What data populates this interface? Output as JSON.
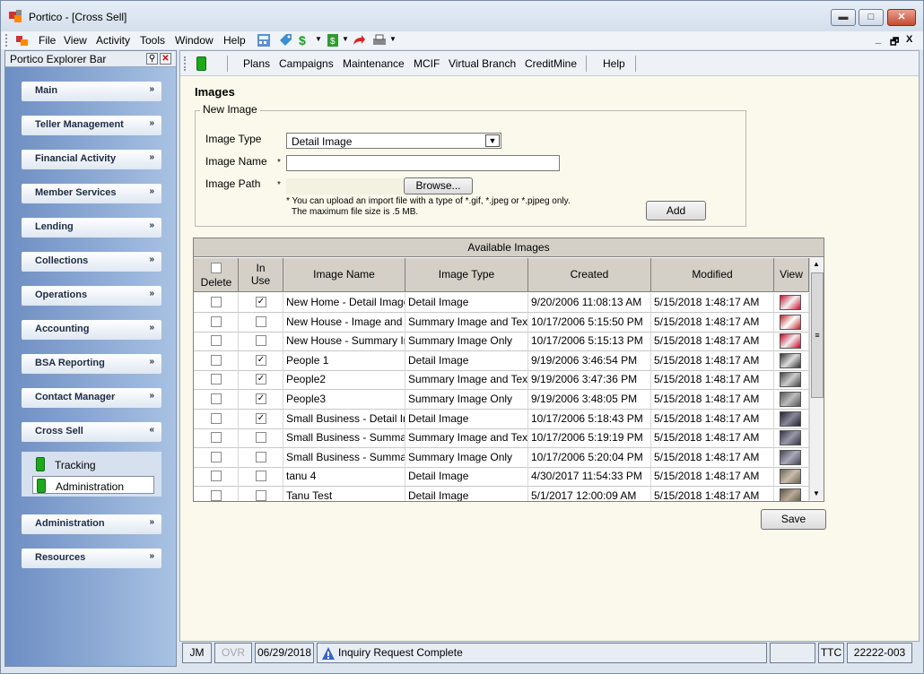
{
  "window": {
    "title": "Portico - [Cross Sell]",
    "min": "▬",
    "max": "□",
    "close": "✕"
  },
  "menubar": {
    "items": [
      "File",
      "View",
      "Activity",
      "Tools",
      "Window",
      "Help"
    ],
    "mdi": [
      "_",
      "🗗",
      "X"
    ]
  },
  "explorer": {
    "title": "Portico Explorer Bar",
    "sections": [
      "Main",
      "Teller Management",
      "Financial Activity",
      "Member Services",
      "Lending",
      "Collections",
      "Operations",
      "Accounting",
      "BSA Reporting",
      "Contact Manager",
      "Cross Sell",
      "Administration",
      "Resources"
    ],
    "chev_down": "»",
    "chev_up": "«",
    "cross_sell_items": [
      "Tracking",
      "Administration"
    ]
  },
  "nav": {
    "items": [
      "Plans",
      "Campaigns",
      "Maintenance",
      "MCIF",
      "Virtual Branch",
      "CreditMine",
      "Help"
    ]
  },
  "page": {
    "title": "Images"
  },
  "form": {
    "legend": "New Image",
    "image_type_label": "Image Type",
    "image_type_value": "Detail Image",
    "image_name_label": "Image Name",
    "image_name_value": "",
    "image_path_label": "Image Path",
    "required_mark": "*",
    "browse_label": "Browse...",
    "note1": "* You can upload an import file with a type of *.gif, *.jpeg or *.pjpeg only.",
    "note2": "The maximum file size is .5 MB.",
    "add_label": "Add"
  },
  "grid": {
    "caption": "Available Images",
    "headers": {
      "delete": "Delete",
      "in_use_1": "In",
      "in_use_2": "Use",
      "name": "Image Name",
      "type": "Image Type",
      "created": "Created",
      "modified": "Modified",
      "view": "View"
    },
    "rows": [
      {
        "in_use": true,
        "name": "New Home - Detail Image",
        "type": "Detail Image",
        "created": "9/20/2006 11:08:13 AM",
        "modified": "5/15/2018 1:48:17 AM"
      },
      {
        "in_use": false,
        "name": "New House - Image and Text",
        "type": "Summary Image and Text",
        "created": "10/17/2006 5:15:50 PM",
        "modified": "5/15/2018 1:48:17 AM"
      },
      {
        "in_use": false,
        "name": "New House - Summary Image",
        "type": "Summary Image Only",
        "created": "10/17/2006 5:15:13 PM",
        "modified": "5/15/2018 1:48:17 AM"
      },
      {
        "in_use": true,
        "name": "People 1",
        "type": "Detail Image",
        "created": "9/19/2006 3:46:54 PM",
        "modified": "5/15/2018 1:48:17 AM"
      },
      {
        "in_use": true,
        "name": "People2",
        "type": "Summary Image and Text",
        "created": "9/19/2006 3:47:36 PM",
        "modified": "5/15/2018 1:48:17 AM"
      },
      {
        "in_use": true,
        "name": "People3",
        "type": "Summary Image Only",
        "created": "9/19/2006 3:48:05 PM",
        "modified": "5/15/2018 1:48:17 AM"
      },
      {
        "in_use": true,
        "name": "Small Business - Detail Image",
        "type": "Detail Image",
        "created": "10/17/2006 5:18:43 PM",
        "modified": "5/15/2018 1:48:17 AM"
      },
      {
        "in_use": false,
        "name": "Small Business - Summary Image and Text",
        "type": "Summary Image and Text",
        "created": "10/17/2006 5:19:19 PM",
        "modified": "5/15/2018 1:48:17 AM"
      },
      {
        "in_use": false,
        "name": "Small Business - Summary Image",
        "type": "Summary Image Only",
        "created": "10/17/2006 5:20:04 PM",
        "modified": "5/15/2018 1:48:17 AM"
      },
      {
        "in_use": false,
        "name": "tanu 4",
        "type": "Detail Image",
        "created": "4/30/2017 11:54:33 PM",
        "modified": "5/15/2018 1:48:17 AM"
      },
      {
        "in_use": false,
        "name": "Tanu Test",
        "type": "Detail Image",
        "created": "5/1/2017 12:00:09 AM",
        "modified": "5/15/2018 1:48:17 AM"
      }
    ],
    "check_mark": "✓",
    "scroll_up": "▲",
    "scroll_down": "▼",
    "scroll_grip": "≡"
  },
  "save_label": "Save",
  "status": {
    "user": "JM",
    "ovr": "OVR",
    "date": "06/29/2018",
    "message": "Inquiry Request Complete",
    "ttc": "TTC",
    "code": "22222-003"
  },
  "colors": {
    "accent": "#1ea81e",
    "explorer_top": "#6d8ec3",
    "explorer_bottom": "#a9c2e3",
    "content_bg": "#fbf9eb"
  }
}
